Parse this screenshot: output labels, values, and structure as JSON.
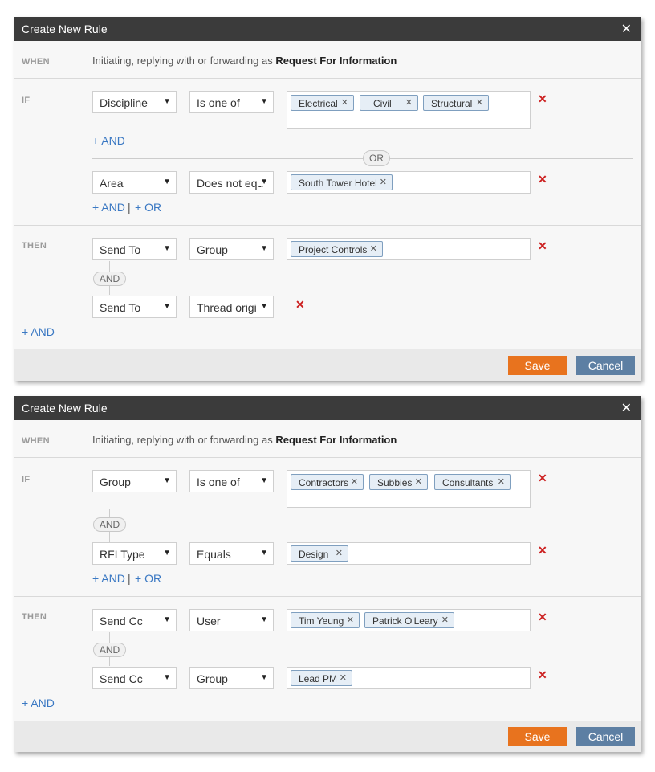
{
  "rule1": {
    "title": "Create New Rule",
    "close_icon": "✕",
    "when": {
      "label": "WHEN",
      "text": "Initiating, replying with or forwarding as",
      "bold": "Request For Information"
    },
    "if": {
      "label": "IF",
      "row1": {
        "field": "Discipline",
        "op": "Is one of",
        "tags": [
          "Electrical",
          "Civil",
          "Structural"
        ]
      },
      "and_link": "+ AND",
      "or_pill": "OR",
      "row2": {
        "field": "Area",
        "op": "Does not equ",
        "tags": [
          "South Tower Hotel"
        ]
      },
      "and_link2": "+ AND",
      "pipe": "|",
      "or_link": "+ OR"
    },
    "then": {
      "label": "THEN",
      "row1": {
        "field": "Send To",
        "op": "Group",
        "tags": [
          "Project Controls"
        ]
      },
      "and_pill": "AND",
      "row2": {
        "field": "Send To",
        "op": "Thread origi"
      },
      "and_link": "+ AND"
    },
    "save": "Save",
    "cancel": "Cancel"
  },
  "rule2": {
    "title": "Create New Rule",
    "close_icon": "✕",
    "when": {
      "label": "WHEN",
      "text": "Initiating, replying with or forwarding as",
      "bold": "Request For Information"
    },
    "if": {
      "label": "IF",
      "row1": {
        "field": "Group",
        "op": "Is one of",
        "tags": [
          "Contractors",
          "Subbies",
          "Consultants"
        ]
      },
      "and_pill": "AND",
      "row2": {
        "field": "RFI Type",
        "op": "Equals",
        "tags": [
          "Design"
        ]
      },
      "and_link": "+ AND",
      "pipe": "|",
      "or_link": "+ OR"
    },
    "then": {
      "label": "THEN",
      "row1": {
        "field": "Send Cc",
        "op": "User",
        "tags": [
          "Tim Yeung",
          "Patrick O'Leary"
        ]
      },
      "and_pill": "AND",
      "row2": {
        "field": "Send Cc",
        "op": "Group",
        "tags": [
          "Lead PM"
        ]
      },
      "and_link": "+ AND"
    },
    "save": "Save",
    "cancel": "Cancel"
  },
  "icons": {
    "dropdown": "chevron-down-icon",
    "tag_remove": "close-icon",
    "row_delete": "delete-icon"
  },
  "colors": {
    "save": "#e8731e",
    "cancel": "#5d7fa3",
    "titlebar": "#3b3b3b",
    "link": "#3a78c3",
    "delete": "#cc1f1f",
    "tag_bg": "#e6eef6"
  }
}
